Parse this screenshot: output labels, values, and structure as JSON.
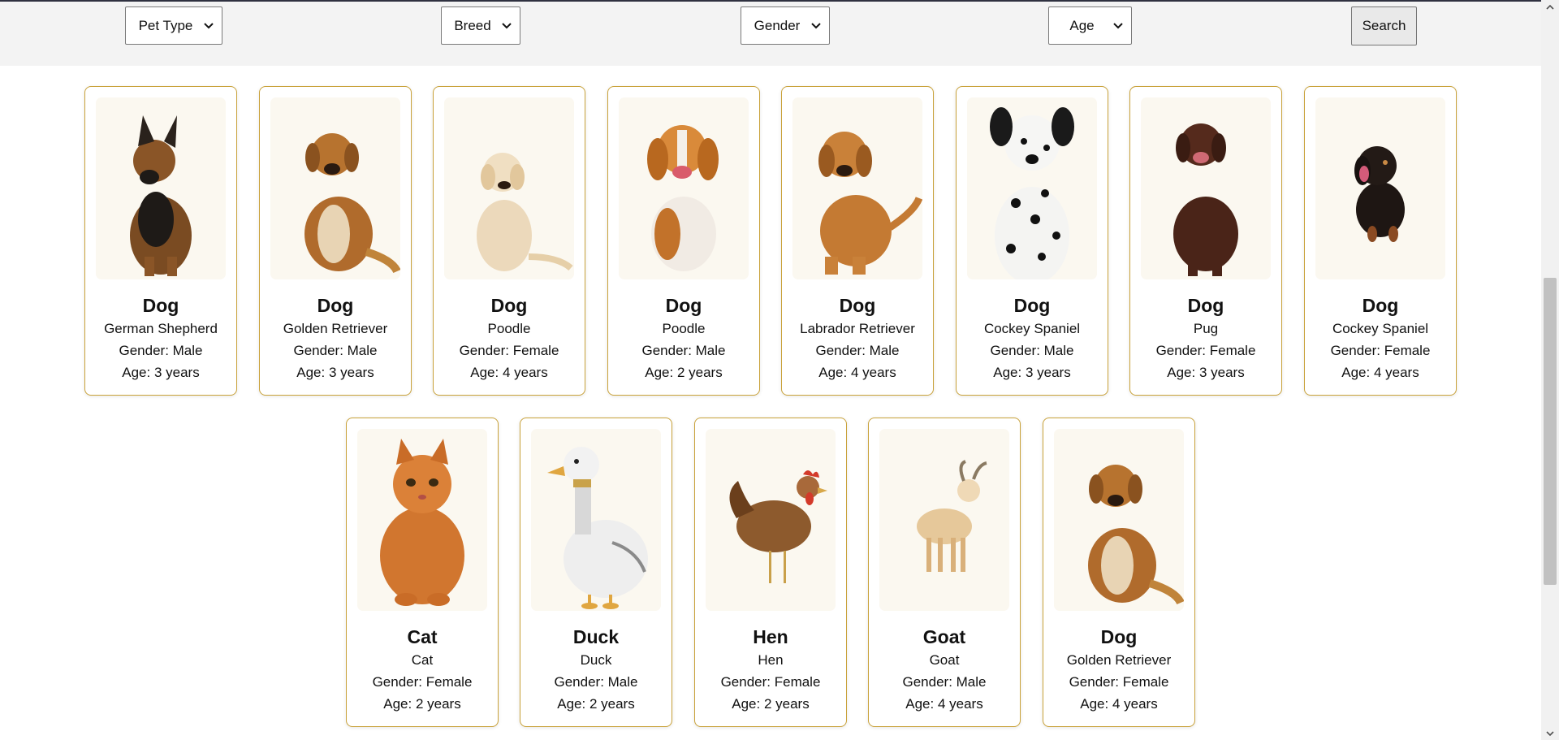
{
  "filters": {
    "pet_type": "Pet Type",
    "breed": "Breed",
    "gender": "Gender",
    "age": "Age",
    "search_label": "Search"
  },
  "colors": {
    "card_border": "#c9a23a",
    "filter_bar": "#f3f3f3"
  },
  "pets": [
    {
      "type": "Dog",
      "breed": "German Shepherd",
      "gender": "Gender: Male",
      "age": "Age: 3 years",
      "icon": "german-shepherd-photo"
    },
    {
      "type": "Dog",
      "breed": "Golden Retriever",
      "gender": "Gender: Male",
      "age": "Age: 3 years",
      "icon": "golden-retriever-photo"
    },
    {
      "type": "Dog",
      "breed": "Poodle",
      "gender": "Gender: Female",
      "age": "Age: 4 years",
      "icon": "poodle-photo"
    },
    {
      "type": "Dog",
      "breed": "Poodle",
      "gender": "Gender: Male",
      "age": "Age: 2 years",
      "icon": "beagle-photo"
    },
    {
      "type": "Dog",
      "breed": "Labrador Retriever",
      "gender": "Gender: Male",
      "age": "Age: 4 years",
      "icon": "labrador-photo"
    },
    {
      "type": "Dog",
      "breed": "Cockey Spaniel",
      "gender": "Gender: Male",
      "age": "Age: 3 years",
      "icon": "dalmatian-photo"
    },
    {
      "type": "Dog",
      "breed": "Pug",
      "gender": "Gender: Female",
      "age": "Age: 3 years",
      "icon": "chocolate-lab-photo"
    },
    {
      "type": "Dog",
      "breed": "Cockey Spaniel",
      "gender": "Gender: Female",
      "age": "Age: 4 years",
      "icon": "dachshund-photo"
    },
    {
      "type": "Cat",
      "breed": "Cat",
      "gender": "Gender: Female",
      "age": "Age: 2 years",
      "icon": "cat-photo"
    },
    {
      "type": "Duck",
      "breed": "Duck",
      "gender": "Gender: Male",
      "age": "Age: 2 years",
      "icon": "duck-photo"
    },
    {
      "type": "Hen",
      "breed": "Hen",
      "gender": "Gender: Female",
      "age": "Age: 2 years",
      "icon": "hen-photo"
    },
    {
      "type": "Goat",
      "breed": "Goat",
      "gender": "Gender: Male",
      "age": "Age: 4 years",
      "icon": "goat-photo"
    },
    {
      "type": "Dog",
      "breed": "Golden Retriever",
      "gender": "Gender: Female",
      "age": "Age: 4 years",
      "icon": "golden-retriever-photo"
    }
  ]
}
